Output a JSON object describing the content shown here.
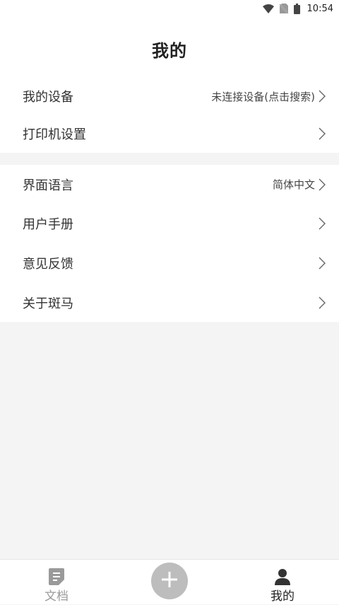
{
  "status_bar": {
    "time": "10:54",
    "icons": [
      "wifi-icon",
      "no-sim-icon",
      "battery-icon"
    ]
  },
  "header": {
    "title": "我的"
  },
  "settings": {
    "group1": [
      {
        "label": "我的设备",
        "value": "未连接设备(点击搜索)"
      },
      {
        "label": "打印机设置",
        "value": ""
      }
    ],
    "group2": [
      {
        "label": "界面语言",
        "value": "简体中文"
      },
      {
        "label": "用户手册",
        "value": ""
      },
      {
        "label": "意见反馈",
        "value": ""
      },
      {
        "label": "关于斑马",
        "value": ""
      }
    ]
  },
  "bottom_nav": {
    "documents_label": "文档",
    "add_icon": "plus-icon",
    "mine_label": "我的",
    "active": "mine"
  },
  "colors": {
    "background": "#f4f4f4",
    "surface": "#ffffff",
    "add_button": "#bdbdbd",
    "inactive_text": "#9a9a9a"
  }
}
